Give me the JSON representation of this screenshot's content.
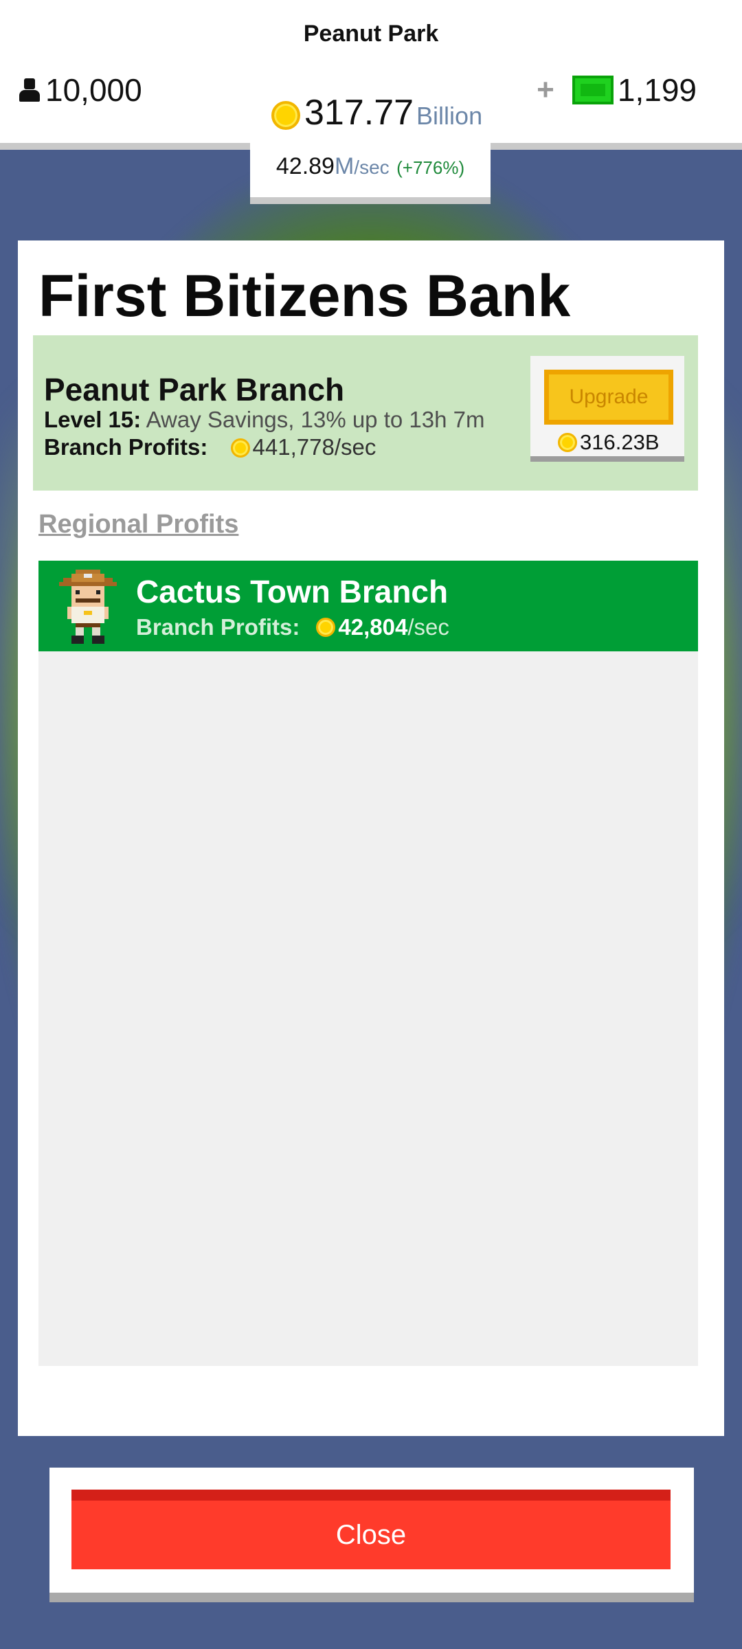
{
  "header": {
    "city_name": "Peanut Park",
    "population": "10,000",
    "coins_value": "317.77",
    "coins_unit": "Billion",
    "plus": "+",
    "cash": "1,199",
    "rate_value": "42.89",
    "rate_unit": "M",
    "rate_unit_suffix": "/sec",
    "rate_change": "(+776%)"
  },
  "panel": {
    "title": "First Bitizens Bank",
    "branch": {
      "name": "Peanut Park Branch",
      "level_label": "Level 15:",
      "level_desc": "Away Savings, 13% up to 13h 7m",
      "profits_label": "Branch Profits:",
      "profits_value": "441,778/sec",
      "upgrade_label": "Upgrade",
      "upgrade_cost": "316.23B"
    },
    "regional_header": "Regional Profits",
    "regional": [
      {
        "name": "Cactus Town Branch",
        "profits_label": "Branch Profits:",
        "profits_number": "42,804",
        "profits_suffix": "/sec"
      }
    ]
  },
  "footer": {
    "close_label": "Close"
  },
  "colors": {
    "background": "#4a5d8c",
    "branch_card": "#cbe6c1",
    "regional_row": "#009e36",
    "upgrade": "#f7c51c",
    "close": "#ff3b2b"
  }
}
